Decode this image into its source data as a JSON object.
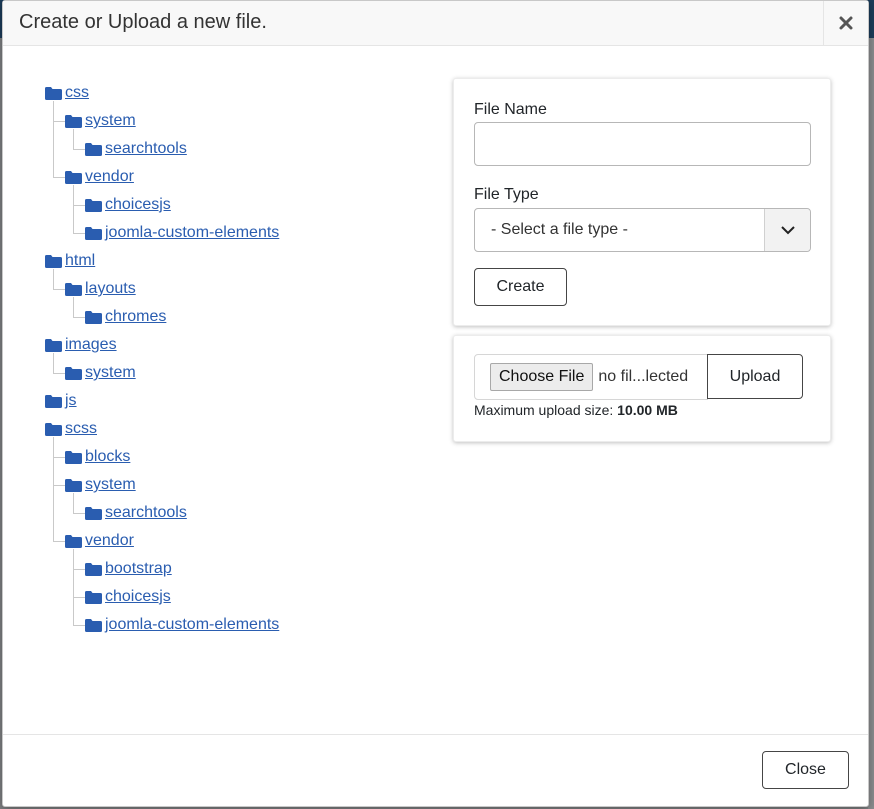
{
  "modal": {
    "title": "Create or Upload a new file.",
    "close_icon": "close-icon"
  },
  "tree": {
    "items": [
      {
        "label": "css",
        "level": 0
      },
      {
        "label": "system",
        "level": 1
      },
      {
        "label": "searchtools",
        "level": 2
      },
      {
        "label": "vendor",
        "level": 1
      },
      {
        "label": "choicesjs",
        "level": 2
      },
      {
        "label": "joomla-custom-elements",
        "level": 2
      },
      {
        "label": "html",
        "level": 0
      },
      {
        "label": "layouts",
        "level": 1
      },
      {
        "label": "chromes",
        "level": 2
      },
      {
        "label": "images",
        "level": 0
      },
      {
        "label": "system",
        "level": 1
      },
      {
        "label": "js",
        "level": 0
      },
      {
        "label": "scss",
        "level": 0
      },
      {
        "label": "blocks",
        "level": 1
      },
      {
        "label": "system",
        "level": 1
      },
      {
        "label": "searchtools",
        "level": 2
      },
      {
        "label": "vendor",
        "level": 1
      },
      {
        "label": "bootstrap",
        "level": 2
      },
      {
        "label": "choicesjs",
        "level": 2
      },
      {
        "label": "joomla-custom-elements",
        "level": 2
      }
    ],
    "icon": "folder-icon",
    "accent_color": "#2a5db0"
  },
  "create_form": {
    "file_name_label": "File Name",
    "file_name_value": "",
    "file_type_label": "File Type",
    "file_type_selected": "- Select a file type -",
    "create_label": "Create"
  },
  "upload_form": {
    "choose_label": "Choose File",
    "file_status": "no fil...lected",
    "upload_label": "Upload",
    "max_size_label": "Maximum upload size:",
    "max_size_value": "10.00 MB"
  },
  "footer": {
    "close_label": "Close"
  }
}
